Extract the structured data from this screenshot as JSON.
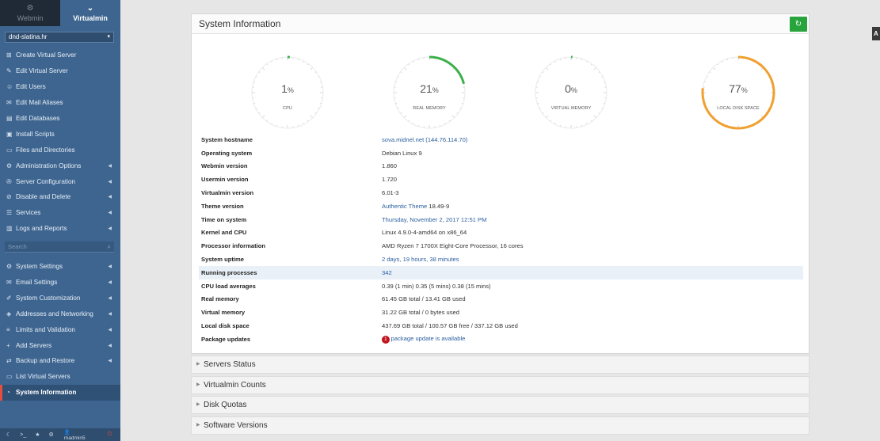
{
  "sidebar": {
    "tabs": [
      {
        "label": "Webmin",
        "icon": "webmin-icon"
      },
      {
        "label": "Virtualmin",
        "icon": "chevron-down-icon"
      }
    ],
    "domain": "dnd-slatina.hr",
    "items_top": [
      {
        "label": "Create Virtual Server",
        "icon": "plus-square-icon",
        "arrow": false
      },
      {
        "label": "Edit Virtual Server",
        "icon": "edit-icon",
        "arrow": false
      },
      {
        "label": "Edit Users",
        "icon": "users-icon",
        "arrow": false
      },
      {
        "label": "Edit Mail Aliases",
        "icon": "mail-icon",
        "arrow": false
      },
      {
        "label": "Edit Databases",
        "icon": "database-icon",
        "arrow": false
      },
      {
        "label": "Install Scripts",
        "icon": "script-icon",
        "arrow": false
      },
      {
        "label": "Files and Directories",
        "icon": "folder-icon",
        "arrow": false
      },
      {
        "label": "Administration Options",
        "icon": "gear-icon",
        "arrow": true
      },
      {
        "label": "Server Configuration",
        "icon": "wrench-icon",
        "arrow": true
      },
      {
        "label": "Disable and Delete",
        "icon": "ban-icon",
        "arrow": true
      },
      {
        "label": "Services",
        "icon": "services-icon",
        "arrow": true
      },
      {
        "label": "Logs and Reports",
        "icon": "chart-icon",
        "arrow": true
      }
    ],
    "search_placeholder": "Search",
    "items_bottom": [
      {
        "label": "System Settings",
        "icon": "cog-icon",
        "arrow": true
      },
      {
        "label": "Email Settings",
        "icon": "envelope-icon",
        "arrow": true
      },
      {
        "label": "System Customization",
        "icon": "brush-icon",
        "arrow": true
      },
      {
        "label": "Addresses and Networking",
        "icon": "shield-icon",
        "arrow": true
      },
      {
        "label": "Limits and Validation",
        "icon": "sliders-icon",
        "arrow": true
      },
      {
        "label": "Add Servers",
        "icon": "plus-icon",
        "arrow": true
      },
      {
        "label": "Backup and Restore",
        "icon": "backup-icon",
        "arrow": true
      },
      {
        "label": "List Virtual Servers",
        "icon": "list-icon",
        "arrow": false
      },
      {
        "label": "System Information",
        "icon": "dashboard-icon",
        "arrow": false,
        "active": true
      }
    ],
    "footer_user": "madmin5"
  },
  "panel": {
    "title": "System Information",
    "gauges": [
      {
        "value": "1",
        "unit": "%",
        "label": "CPU",
        "percent": 1,
        "color": "#3cb04a"
      },
      {
        "value": "21",
        "unit": "%",
        "label": "REAL MEMORY",
        "percent": 21,
        "color": "#3cb04a"
      },
      {
        "value": "0",
        "unit": "%",
        "label": "VIRTUAL MEMORY",
        "percent": 0,
        "color": "#3cb04a"
      },
      {
        "value": "77",
        "unit": "%",
        "label": "LOCAL DISK SPACE",
        "percent": 77,
        "color": "#f0a030"
      }
    ],
    "rows": [
      {
        "key": "System hostname",
        "value": "sova.midnel.net (144.76.114.70)",
        "link": true
      },
      {
        "key": "Operating system",
        "value": "Debian Linux 9"
      },
      {
        "key": "Webmin version",
        "value": "1.860"
      },
      {
        "key": "Usermin version",
        "value": "1.720"
      },
      {
        "key": "Virtualmin version",
        "value": "6.01-3"
      },
      {
        "key": "Theme version",
        "value_link": "Authentic Theme",
        "value": "18.49-9"
      },
      {
        "key": "Time on system",
        "value": "Thursday, November 2, 2017 12:51 PM",
        "link": true
      },
      {
        "key": "Kernel and CPU",
        "value": "Linux 4.9.0-4-amd64 on x86_64"
      },
      {
        "key": "Processor information",
        "value": "AMD Ryzen 7 1700X Eight-Core Processor, 16 cores"
      },
      {
        "key": "System uptime",
        "value": "2 days, 19 hours, 38 minutes",
        "link": true
      },
      {
        "key": "Running processes",
        "value": "342",
        "link": true,
        "highlight": true
      },
      {
        "key": "CPU load averages",
        "value": "0.39 (1 min) 0.35 (5 mins) 0.38 (15 mins)"
      },
      {
        "key": "Real memory",
        "value": "61.45 GB total / 13.41 GB used"
      },
      {
        "key": "Virtual memory",
        "value": "31.22 GB total / 0 bytes used"
      },
      {
        "key": "Local disk space",
        "value": "437.69 GB total / 100.57 GB free / 337.12 GB used"
      },
      {
        "key": "Package updates",
        "badge": "1",
        "value": "package update is available",
        "link": true
      }
    ]
  },
  "sections": [
    "Servers Status",
    "Virtualmin Counts",
    "Disk Quotas",
    "Software Versions"
  ],
  "right_tab": "A"
}
